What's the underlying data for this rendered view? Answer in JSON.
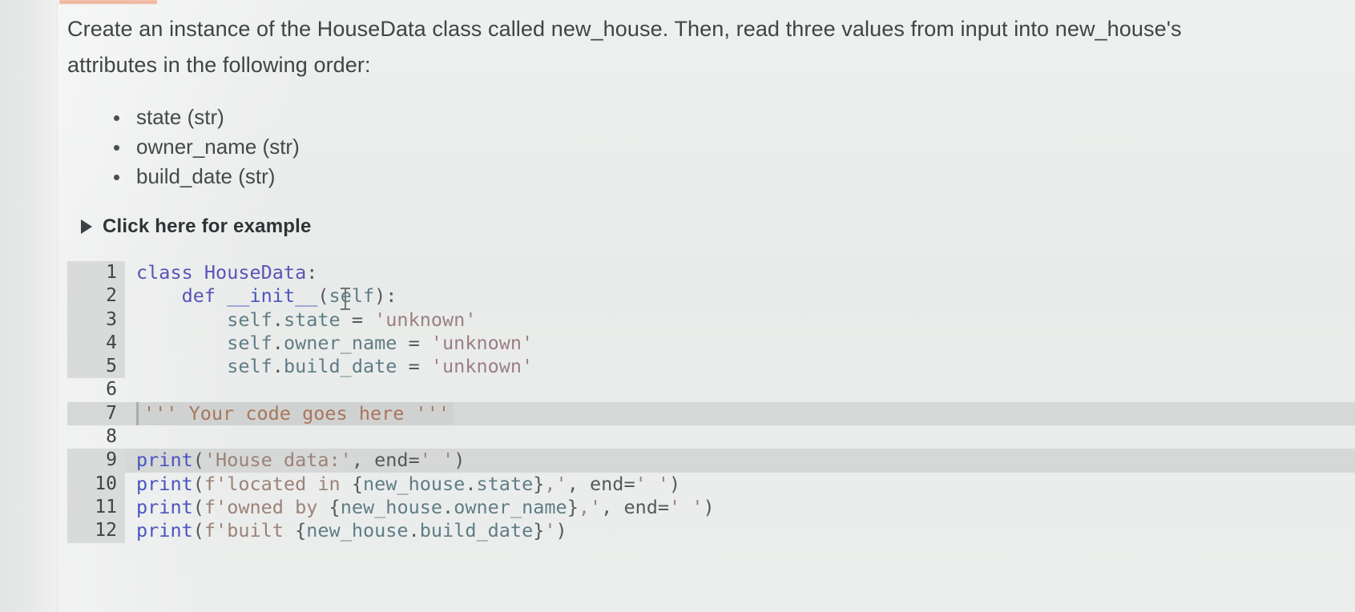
{
  "prompt": {
    "text": "Create an instance of the HouseData class called new_house. Then, read three values from input into new_house's attributes in the following order:"
  },
  "attributes": [
    {
      "label": "state (str)"
    },
    {
      "label": "owner_name (str)"
    },
    {
      "label": "build_date (str)"
    }
  ],
  "disclosure": {
    "label": "Click here for example",
    "state": "collapsed",
    "icon": "triangle-right-icon"
  },
  "editor": {
    "language": "python",
    "editable_lines": [
      6,
      7,
      8
    ],
    "readonly_lines": [
      1,
      2,
      3,
      4,
      5,
      9,
      10,
      11,
      12
    ],
    "lines": [
      {
        "n": "1",
        "text": "class HouseData:"
      },
      {
        "n": "2",
        "text": "    def __init__(self):"
      },
      {
        "n": "3",
        "text": "        self.state = 'unknown'"
      },
      {
        "n": "4",
        "text": "        self.owner_name = 'unknown'"
      },
      {
        "n": "5",
        "text": "        self.build_date = 'unknown'"
      },
      {
        "n": "6",
        "text": ""
      },
      {
        "n": "7",
        "text": "''' Your code goes here '''"
      },
      {
        "n": "8",
        "text": ""
      },
      {
        "n": "9",
        "text": "print('House data:', end=' ')"
      },
      {
        "n": "10",
        "text": "print(f'located in {new_house.state},', end=' ')"
      },
      {
        "n": "11",
        "text": "print(f'owned by {new_house.owner_name},', end=' ')"
      },
      {
        "n": "12",
        "text": "print(f'built {new_house.build_date}')"
      }
    ],
    "tokens": {
      "l1": {
        "kw": "class",
        "name": " HouseData",
        "pun": ":"
      },
      "l2": {
        "indent": "    ",
        "kw": "def",
        "name": " __init__",
        "pun1": "(",
        "slf": "self",
        "pun2": "):"
      },
      "l3": {
        "indent": "        ",
        "slf": "self",
        "dot": ".",
        "attr": "state",
        "op": " = ",
        "str": "'unknown'"
      },
      "l4": {
        "indent": "        ",
        "slf": "self",
        "dot": ".",
        "attr": "owner_name",
        "op": " = ",
        "str": "'unknown'"
      },
      "l5": {
        "indent": "        ",
        "slf": "self",
        "dot": ".",
        "attr": "build_date",
        "op": " = ",
        "str": "'unknown'"
      },
      "l7": {
        "text": "''' Your code goes here '''"
      },
      "l9": {
        "fn": "print",
        "p1": "(",
        "str": "'House data:'",
        "c": ", ",
        "kwarg": "end=",
        "str2": "' '",
        "p2": ")"
      },
      "l10": {
        "fn": "print",
        "p1": "(",
        "fstr": "f'located in ",
        "brace1": "{",
        "obj": "new_house",
        "dot": ".",
        "attr": "state",
        "brace2": "}",
        "rest": ",'",
        "c": ", ",
        "kwarg": "end=",
        "str2": "' '",
        "p2": ")"
      },
      "l11": {
        "fn": "print",
        "p1": "(",
        "fstr": "f'owned by ",
        "brace1": "{",
        "obj": "new_house",
        "dot": ".",
        "attr": "owner_name",
        "brace2": "}",
        "rest": ",'",
        "c": ", ",
        "kwarg": "end=",
        "str2": "' '",
        "p2": ")"
      },
      "l12": {
        "fn": "print",
        "p1": "(",
        "fstr": "f'built ",
        "brace1": "{",
        "obj": "new_house",
        "dot": ".",
        "attr": "build_date",
        "brace2": "}",
        "rest": "'",
        "p2": ")"
      }
    }
  },
  "colors": {
    "page_background": "#eceeed",
    "keyword": "#5b53b8",
    "function": "#4a55c0",
    "self_attr": "#5f7d86",
    "string": "#9b7f84",
    "fstring": "#9c8277",
    "comment": "#a8765a",
    "gutter_readonly": "#d9dbda",
    "highlight_band": "#d6d8d7",
    "top_accent": "#f0a083",
    "body_text": "#404446"
  }
}
